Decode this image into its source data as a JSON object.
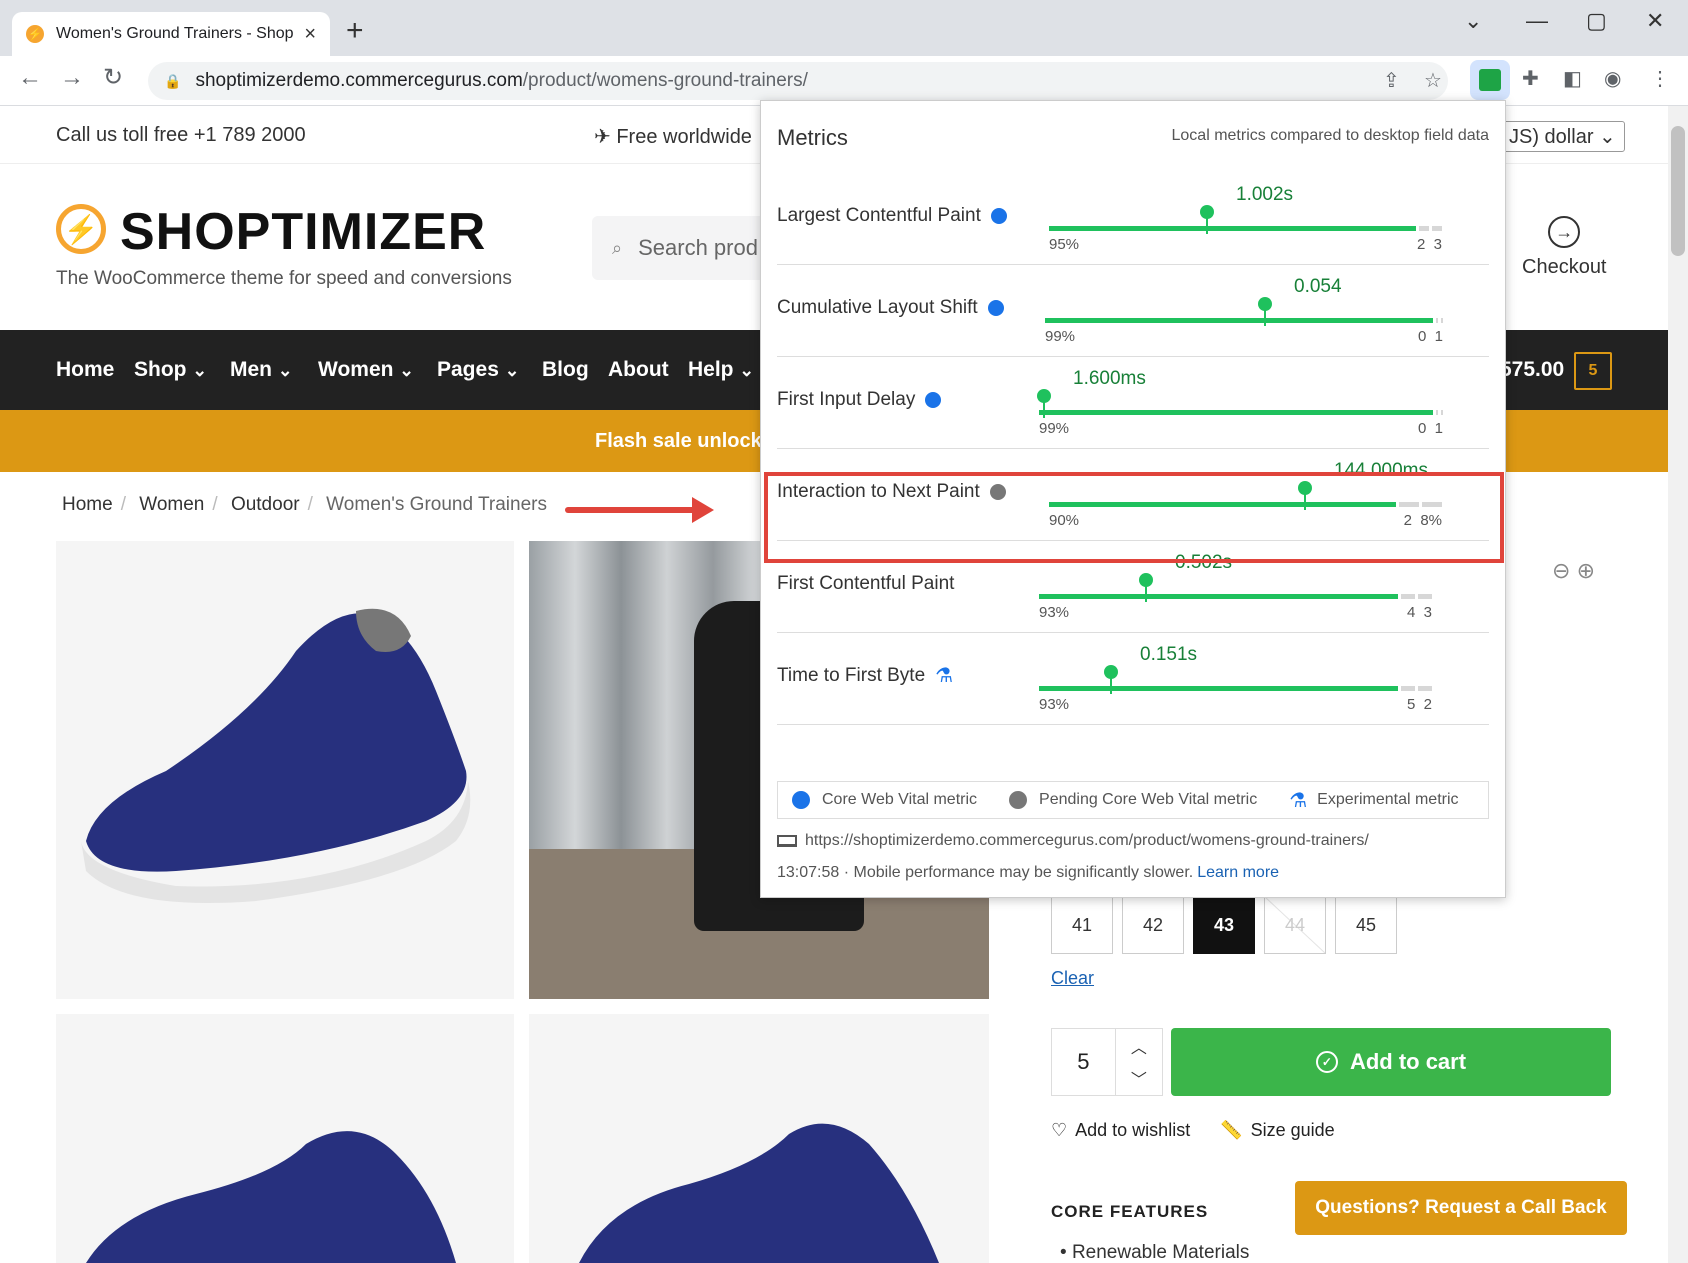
{
  "browser": {
    "tab_title": "Women's Ground Trainers - Shop",
    "new_tab": "+",
    "url_host": "shoptimizerdemo.commercegurus.com",
    "url_path": "/product/womens-ground-trainers/"
  },
  "site": {
    "topbar": {
      "call": "Call us toll free +1 789 2000",
      "shipping": "Free worldwide",
      "currency": "JS) dollar"
    },
    "logo": "SHOPTIMIZER",
    "tagline": "The WooCommerce theme for speed and conversions",
    "search_placeholder": "Search prod",
    "checkout": "Checkout",
    "nav": [
      "Home",
      "Shop",
      "Men",
      "Women",
      "Pages",
      "Blog",
      "About",
      "Help"
    ],
    "cart_total": "575.00",
    "cart_count": "5",
    "flash": "Flash sale unlocked",
    "breadcrumb": [
      "Home",
      "Women",
      "Outdoor",
      "Women's Ground Trainers"
    ],
    "sizes": [
      {
        "label": "41",
        "state": "normal"
      },
      {
        "label": "42",
        "state": "normal"
      },
      {
        "label": "43",
        "state": "selected"
      },
      {
        "label": "44",
        "state": "disabled"
      },
      {
        "label": "45",
        "state": "normal"
      }
    ],
    "clear": "Clear",
    "quantity": "5",
    "add_to_cart": "Add to cart",
    "wishlist": "Add to wishlist",
    "size_guide": "Size guide",
    "core_features": "CORE FEATURES",
    "feature_1": "Renewable Materials",
    "callback": "Questions? Request a Call Back"
  },
  "metrics_panel": {
    "title": "Metrics",
    "subtitle": "Local metrics compared to desktop field data",
    "metrics": [
      {
        "name": "Largest Contentful Paint",
        "value": "1.002s",
        "good_pct": "95%",
        "ni_pct": "2",
        "poor_pct": "3",
        "status": "core",
        "good_share": 0.95,
        "marker": 0.4
      },
      {
        "name": "Cumulative Layout Shift",
        "value": "0.054",
        "good_pct": "99%",
        "ni_pct": "0",
        "poor_pct": "1",
        "status": "core",
        "good_share": 0.99,
        "marker": 0.55
      },
      {
        "name": "First Input Delay",
        "value": "1.600ms",
        "good_pct": "99%",
        "ni_pct": "0",
        "poor_pct": "1",
        "status": "core",
        "good_share": 0.99,
        "marker": 0.01
      },
      {
        "name": "Interaction to Next Paint",
        "value": "144.000ms",
        "good_pct": "90%",
        "ni_pct": "2",
        "poor_pct": "8%",
        "status": "pending",
        "good_share": 0.9,
        "marker": 0.65
      },
      {
        "name": "First Contentful Paint",
        "value": "0.502s",
        "good_pct": "93%",
        "ni_pct": "4",
        "poor_pct": "3",
        "status": "none",
        "good_share": 0.93,
        "marker": 0.27
      },
      {
        "name": "Time to First Byte",
        "value": "0.151s",
        "good_pct": "93%",
        "ni_pct": "5",
        "poor_pct": "2",
        "status": "experimental",
        "good_share": 0.93,
        "marker": 0.18
      }
    ],
    "legend": {
      "core": "Core Web Vital metric",
      "pending": "Pending Core Web Vital metric",
      "experimental": "Experimental metric"
    },
    "page_url": "https://shoptimizerdemo.commercegurus.com/product/womens-ground-trainers/",
    "footer_time": "13:07:58",
    "footer_note": "· Mobile performance may be significantly slower.",
    "learn_more": "Learn more"
  },
  "colors": {
    "accent_orange": "#dc9814",
    "good_green": "#1fc15d",
    "cart_green": "#3bb54a",
    "core_blue": "#1a73e8",
    "highlight_red": "#e0443b"
  }
}
